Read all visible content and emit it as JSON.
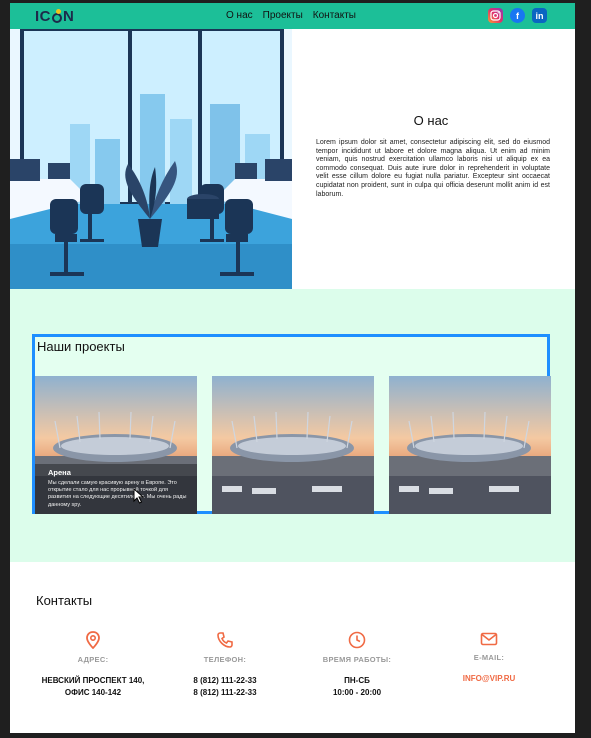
{
  "header": {
    "logo_text": "ICON",
    "nav": [
      "О нас",
      "Проекты",
      "Контакты"
    ],
    "social": [
      "instagram-icon",
      "facebook-icon",
      "linkedin-icon"
    ]
  },
  "about": {
    "title": "О нас",
    "body": "Lorem ipsum dolor sit amet, consectetur adipiscing elit, sed do eiusmod tempor incididunt ut labore et dolore magna aliqua. Ut enim ad minim veniam, quis nostrud exercitation ullamco laboris nisi ut aliquip ex ea commodo consequat. Duis aute irure dolor in reprehenderit in voluptate velit esse cillum dolore eu fugiat nulla pariatur. Excepteur sint occaecat cupidatat non proident, sunt in culpa qui officia deserunt mollit anim id est laborum."
  },
  "projects": {
    "title": "Наши проекты",
    "cards": [
      {
        "name": "Арена",
        "desc": "Мы сделали самую красивую арену в Европе. Это открытие стало для нас прорывной точкой для развития на следующие десятилетия. Мы очень рады данному spy."
      },
      {
        "name": "",
        "desc": ""
      },
      {
        "name": "",
        "desc": ""
      }
    ]
  },
  "contacts": {
    "title": "Контакты",
    "columns": [
      {
        "icon": "map-pin-icon",
        "label": "АДРЕС:",
        "line1": "НЕВСКИЙ ПРОСПЕКТ 140,",
        "line2": "ОФИС 140-142"
      },
      {
        "icon": "phone-icon",
        "label": "ТЕЛЕФОН:",
        "line1": "8 (812) 111-22-33",
        "line2": "8 (812) 111-22-33"
      },
      {
        "icon": "clock-icon",
        "label": "ВРЕМЯ РАБОТЫ:",
        "line1": "ПН-СБ",
        "line2": "10:00 - 20:00"
      },
      {
        "icon": "mail-icon",
        "label": "E-MAIL:",
        "line1": "INFO@VIP.RU",
        "line2": ""
      }
    ]
  },
  "colors": {
    "header_bg": "#1cbf98",
    "projects_bg": "#dcfdeb",
    "selection_border": "#1e8fff",
    "contact_accent": "#f06a44"
  }
}
